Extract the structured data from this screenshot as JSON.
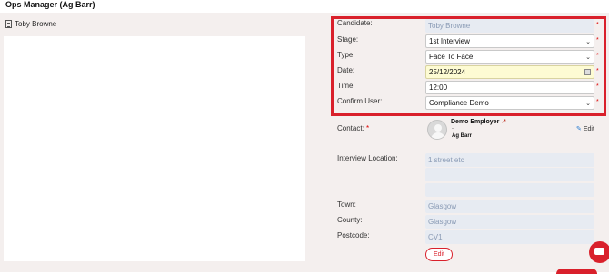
{
  "page": {
    "title": "Ops Manager (Ag Barr)"
  },
  "list": {
    "items": [
      {
        "label": "Toby Browne"
      }
    ]
  },
  "form": {
    "candidate": {
      "label": "Candidate:",
      "value": "Toby Browne"
    },
    "stage": {
      "label": "Stage:",
      "value": "1st Interview"
    },
    "type": {
      "label": "Type:",
      "value": "Face To Face"
    },
    "date": {
      "label": "Date:",
      "value": "25/12/2024"
    },
    "time": {
      "label": "Time:",
      "value": "12:00"
    },
    "confirm_user": {
      "label": "Confirm User:",
      "value": "Compliance Demo"
    },
    "required_mark": "*",
    "contact": {
      "label": "Contact:",
      "name": "Demo Employer",
      "dash": "-",
      "company": "Ag Barr",
      "edit_label": "Edit"
    },
    "interview_location": {
      "label": "Interview Location:",
      "line1": "1 street etc",
      "line2": "",
      "line3": ""
    },
    "town": {
      "label": "Town:",
      "value": "Glasgow"
    },
    "county": {
      "label": "County:",
      "value": "Glasgow"
    },
    "postcode": {
      "label": "Postcode:",
      "value": "CV1"
    },
    "edit_button": "Edit"
  },
  "colors": {
    "accent": "#d9202b",
    "readonly_bg": "#e7ebf2",
    "readonly_text": "#8a9bb5",
    "date_bg": "#fdfbd3",
    "panel_bg": "#f4efee"
  },
  "icons": {
    "list_item": "document-icon",
    "calendar": "calendar-icon",
    "external": "external-link-icon",
    "edit": "pencil-icon",
    "chat": "chat-icon",
    "avatar": "user-avatar-icon"
  }
}
